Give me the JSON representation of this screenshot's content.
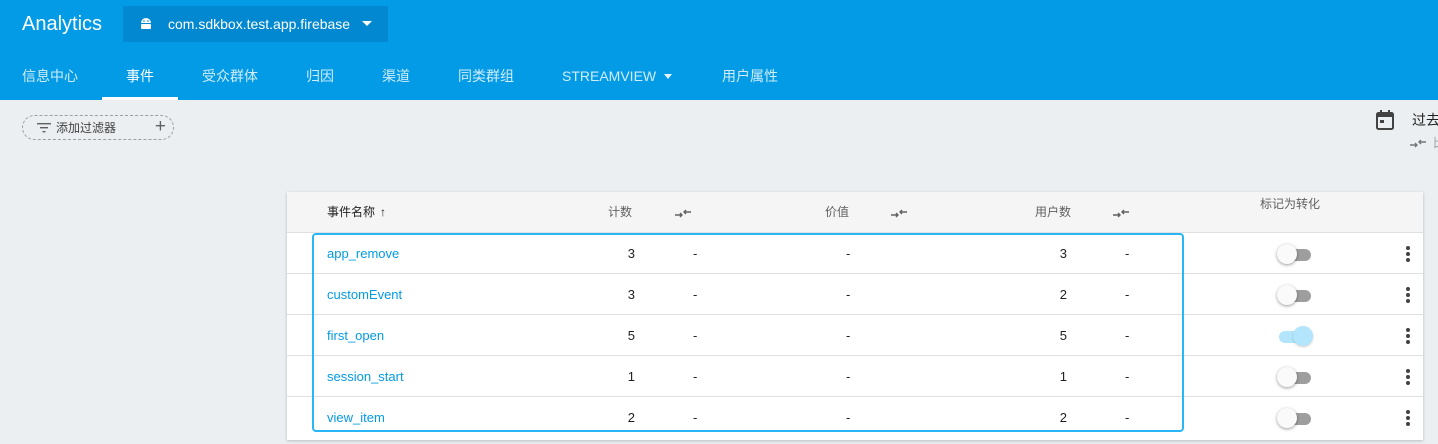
{
  "header": {
    "brand": "Analytics",
    "app_name": "com.sdkbox.test.app.firebase",
    "tabs": [
      {
        "label": "信息中心"
      },
      {
        "label": "事件"
      },
      {
        "label": "受众群体"
      },
      {
        "label": "归因"
      },
      {
        "label": "渠道"
      },
      {
        "label": "同类群组"
      },
      {
        "label": "STREAMVIEW"
      },
      {
        "label": "用户属性"
      }
    ]
  },
  "filter": {
    "label": "添加过滤器",
    "plus": "+"
  },
  "date_range": {
    "label": "过去",
    "compare_label": "比"
  },
  "table": {
    "columns": {
      "name": "事件名称",
      "sort_arrow": "↑",
      "count": "计数",
      "value": "价值",
      "users": "用户数",
      "conversion": "标记为转化"
    },
    "rows": [
      {
        "name": "app_remove",
        "count": "3",
        "count_cmp": "-",
        "value": "-",
        "users": "3",
        "users_cmp": "-",
        "conversion": false
      },
      {
        "name": "customEvent",
        "count": "3",
        "count_cmp": "-",
        "value": "-",
        "users": "2",
        "users_cmp": "-",
        "conversion": false
      },
      {
        "name": "first_open",
        "count": "5",
        "count_cmp": "-",
        "value": "-",
        "users": "5",
        "users_cmp": "-",
        "conversion": true
      },
      {
        "name": "session_start",
        "count": "1",
        "count_cmp": "-",
        "value": "-",
        "users": "1",
        "users_cmp": "-",
        "conversion": false
      },
      {
        "name": "view_item",
        "count": "2",
        "count_cmp": "-",
        "value": "-",
        "users": "2",
        "users_cmp": "-",
        "conversion": false
      }
    ]
  },
  "colors": {
    "header_bg": "#039be5",
    "app_select_bg": "#0288d1",
    "link": "#039be5",
    "highlight": "#29b6f6",
    "toggle_on": "#b3e5fc"
  },
  "icons": [
    "android-icon",
    "dropdown-caret-icon",
    "filter-icon",
    "plus-icon",
    "calendar-icon",
    "compare-icon",
    "sort-arrow-icon",
    "more-vert-icon"
  ]
}
